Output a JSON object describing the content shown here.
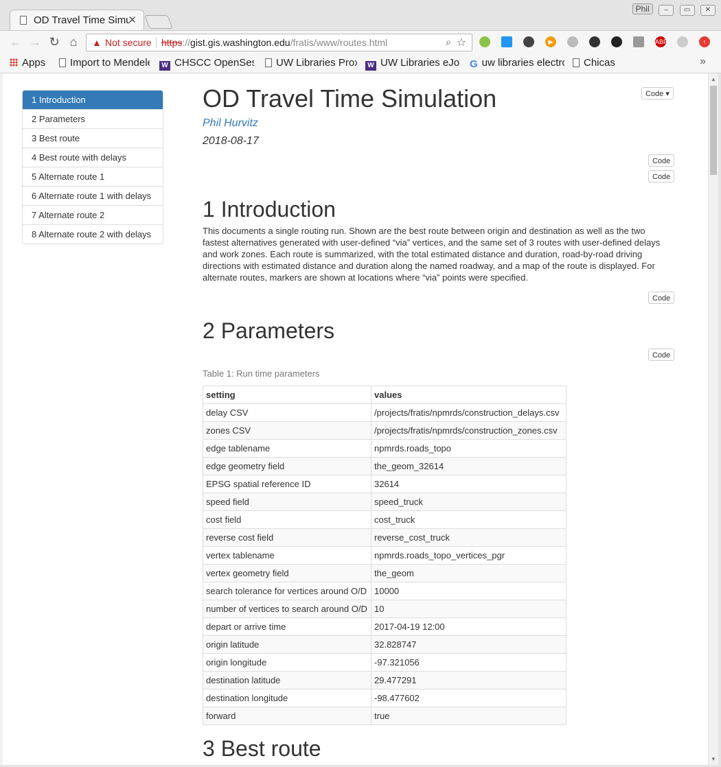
{
  "browser": {
    "tab_title": "OD Travel Time Simulation",
    "profile": "Phil",
    "security_label": "Not secure",
    "url_scheme": "https",
    "url_host": "gist.gis.washington.edu",
    "url_path": "/fratis/www/routes.html",
    "bookmarks": [
      "Apps",
      "Import to Mendeley",
      "CHSCC OpenSesame",
      "UW Libraries Proxy",
      "UW Libraries eJournals",
      "uw libraries electronic",
      "Chicas"
    ]
  },
  "toc": {
    "items": [
      "1 Introduction",
      "2 Parameters",
      "3 Best route",
      "4 Best route with delays",
      "5 Alternate route 1",
      "6 Alternate route 1 with delays",
      "7 Alternate route 2",
      "8 Alternate route 2 with delays"
    ],
    "active_index": 0
  },
  "doc": {
    "code_menu_label": "Code",
    "code_label": "Code",
    "title": "OD Travel Time Simulation",
    "author": "Phil Hurvitz",
    "date": "2018-08-17",
    "section1_heading": "1 Introduction",
    "intro_text": "This documents a single routing run. Shown are the best route between origin and destination as well as the two fastest alternatives generated with user-defined “via” vertices, and the same set of 3 routes with user-defined delays and work zones. Each route is summarized, with the total estimated distance and duration, road-by-road driving directions with estimated distance and duration along the named roadway, and a map of the route is displayed. For alternate routes, markers are shown at locations where “via” points were specified.",
    "section2_heading": "2 Parameters",
    "table_caption": "Table 1: Run time parameters",
    "section3_heading": "3 Best route"
  },
  "params_table": {
    "headers": [
      "setting",
      "values"
    ],
    "rows": [
      [
        "delay CSV",
        "/projects/fratis/npmrds/construction_delays.csv"
      ],
      [
        "zones CSV",
        "/projects/fratis/npmrds/construction_zones.csv"
      ],
      [
        "edge tablename",
        "npmrds.roads_topo"
      ],
      [
        "edge geometry field",
        "the_geom_32614"
      ],
      [
        "EPSG spatial reference ID",
        "32614"
      ],
      [
        "speed field",
        "speed_truck"
      ],
      [
        "cost field",
        "cost_truck"
      ],
      [
        "reverse cost field",
        "reverse_cost_truck"
      ],
      [
        "vertex tablename",
        "npmrds.roads_topo_vertices_pgr"
      ],
      [
        "vertex geometry field",
        "the_geom"
      ],
      [
        "search tolerance for vertices around O/D",
        "10000"
      ],
      [
        "number of vertices to search around O/D",
        "10"
      ],
      [
        "depart or arrive time",
        "2017-04-19 12:00"
      ],
      [
        "origin latitude",
        "32.828747"
      ],
      [
        "origin longitude",
        "-97.321056"
      ],
      [
        "destination latitude",
        "29.477291"
      ],
      [
        "destination longitude",
        "-98.477602"
      ],
      [
        "forward",
        "true"
      ]
    ]
  }
}
